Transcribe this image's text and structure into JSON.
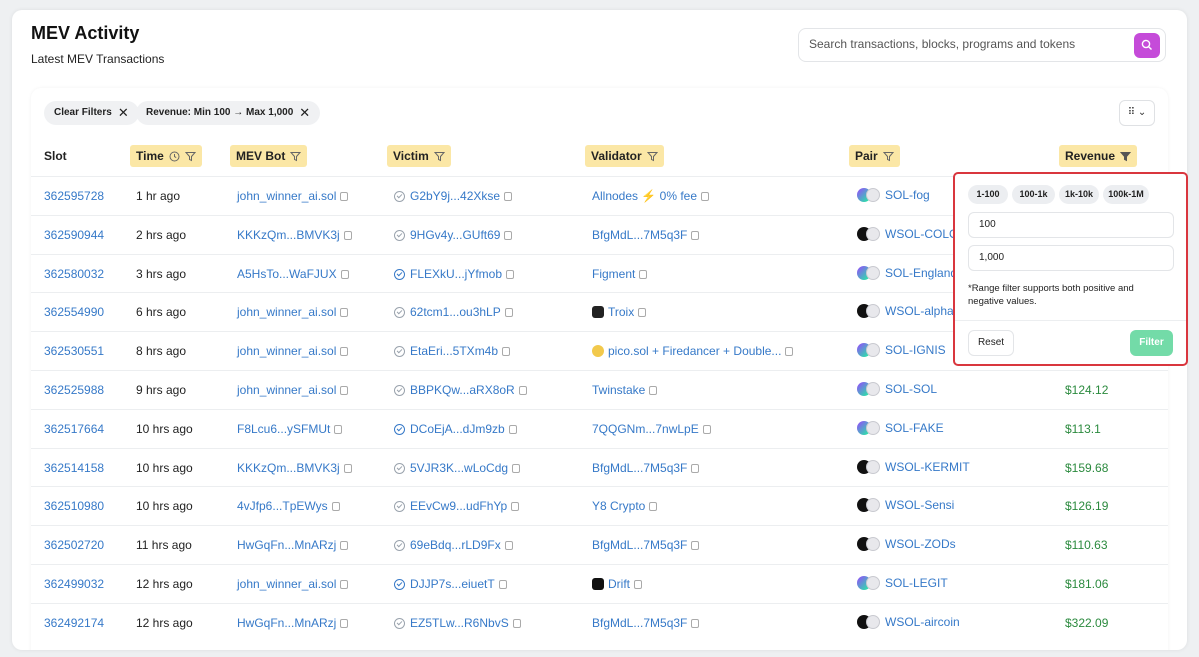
{
  "header": {
    "title": "MEV Activity",
    "subtitle": "Latest MEV Transactions",
    "search_placeholder": "Search transactions, blocks, programs and tokens"
  },
  "filters": {
    "clear_label": "Clear Filters",
    "revenue_chip": "Revenue: Min 100 → Max 1,000"
  },
  "columns": {
    "slot": "Slot",
    "time": "Time",
    "mev_bot": "MEV Bot",
    "victim": "Victim",
    "validator": "Validator",
    "pair": "Pair",
    "revenue": "Revenue"
  },
  "rows": [
    {
      "slot": "362595728",
      "time": "1 hr ago",
      "bot": "john_winner_ai.sol",
      "victim": "G2bY9j...42Xkse",
      "validator": "Allnodes ⚡ 0% fee",
      "pair": "SOL-fog",
      "revenue": ""
    },
    {
      "slot": "362590944",
      "time": "2 hrs ago",
      "bot": "KKKzQm...BMVK3j",
      "victim": "9HGv4y...GUft69",
      "validator": "BfgMdL...7M5q3F",
      "pair": "WSOL-COLOU",
      "revenue": ""
    },
    {
      "slot": "362580032",
      "time": "3 hrs ago",
      "bot": "A5HsTo...WaFJUX",
      "victim": "FLEXkU...jYfmob",
      "validator": "Figment",
      "pair": "SOL-England",
      "revenue": ""
    },
    {
      "slot": "362554990",
      "time": "6 hrs ago",
      "bot": "john_winner_ai.sol",
      "victim": "62tcm1...ou3hLP",
      "validator": "Troix",
      "pair": "WSOL-alpha",
      "revenue": ""
    },
    {
      "slot": "362530551",
      "time": "8 hrs ago",
      "bot": "john_winner_ai.sol",
      "victim": "EtaEri...5TXm4b",
      "validator": "pico.sol + Firedancer + Double...",
      "pair": "SOL-IGNIS",
      "revenue": ""
    },
    {
      "slot": "362525988",
      "time": "9 hrs ago",
      "bot": "john_winner_ai.sol",
      "victim": "BBPKQw...aRX8oR",
      "validator": "Twinstake",
      "pair": "SOL-SOL",
      "revenue": "$124.12"
    },
    {
      "slot": "362517664",
      "time": "10 hrs ago",
      "bot": "F8Lcu6...ySFMUt",
      "victim": "DCoEjA...dJm9zb",
      "validator": "7QQGNm...7nwLpE",
      "pair": "SOL-FAKE",
      "revenue": "$113.1"
    },
    {
      "slot": "362514158",
      "time": "10 hrs ago",
      "bot": "KKKzQm...BMVK3j",
      "victim": "5VJR3K...wLoCdg",
      "validator": "BfgMdL...7M5q3F",
      "pair": "WSOL-KERMIT",
      "revenue": "$159.68"
    },
    {
      "slot": "362510980",
      "time": "10 hrs ago",
      "bot": "4vJfp6...TpEWys",
      "victim": "EEvCw9...udFhYp",
      "validator": "Y8 Crypto",
      "pair": "WSOL-Sensi",
      "revenue": "$126.19"
    },
    {
      "slot": "362502720",
      "time": "11 hrs ago",
      "bot": "HwGqFn...MnARzj",
      "victim": "69eBdq...rLD9Fx",
      "validator": "BfgMdL...7M5q3F",
      "pair": "WSOL-ZODs",
      "revenue": "$110.63"
    },
    {
      "slot": "362499032",
      "time": "12 hrs ago",
      "bot": "john_winner_ai.sol",
      "victim": "DJJP7s...eiuetT",
      "validator": "Drift",
      "pair": "SOL-LEGIT",
      "revenue": "$181.06"
    },
    {
      "slot": "362492174",
      "time": "12 hrs ago",
      "bot": "HwGqFn...MnARzj",
      "victim": "EZ5TLw...R6NbvS",
      "validator": "BfgMdL...7M5q3F",
      "pair": "WSOL-aircoin",
      "revenue": "$322.09"
    }
  ],
  "popup": {
    "presets": [
      "1-100",
      "100-1k",
      "1k-10k",
      "100k-1M"
    ],
    "min_value": "100",
    "max_value": "1,000",
    "hint": "*Range filter supports both positive and negative values.",
    "reset_label": "Reset",
    "filter_label": "Filter"
  },
  "colors": {
    "accent": "#c54bd9",
    "link": "#3679c8",
    "revenue": "#2b8a3e",
    "filter_button": "#73dba8",
    "header_highlight": "#fbe7a6"
  }
}
